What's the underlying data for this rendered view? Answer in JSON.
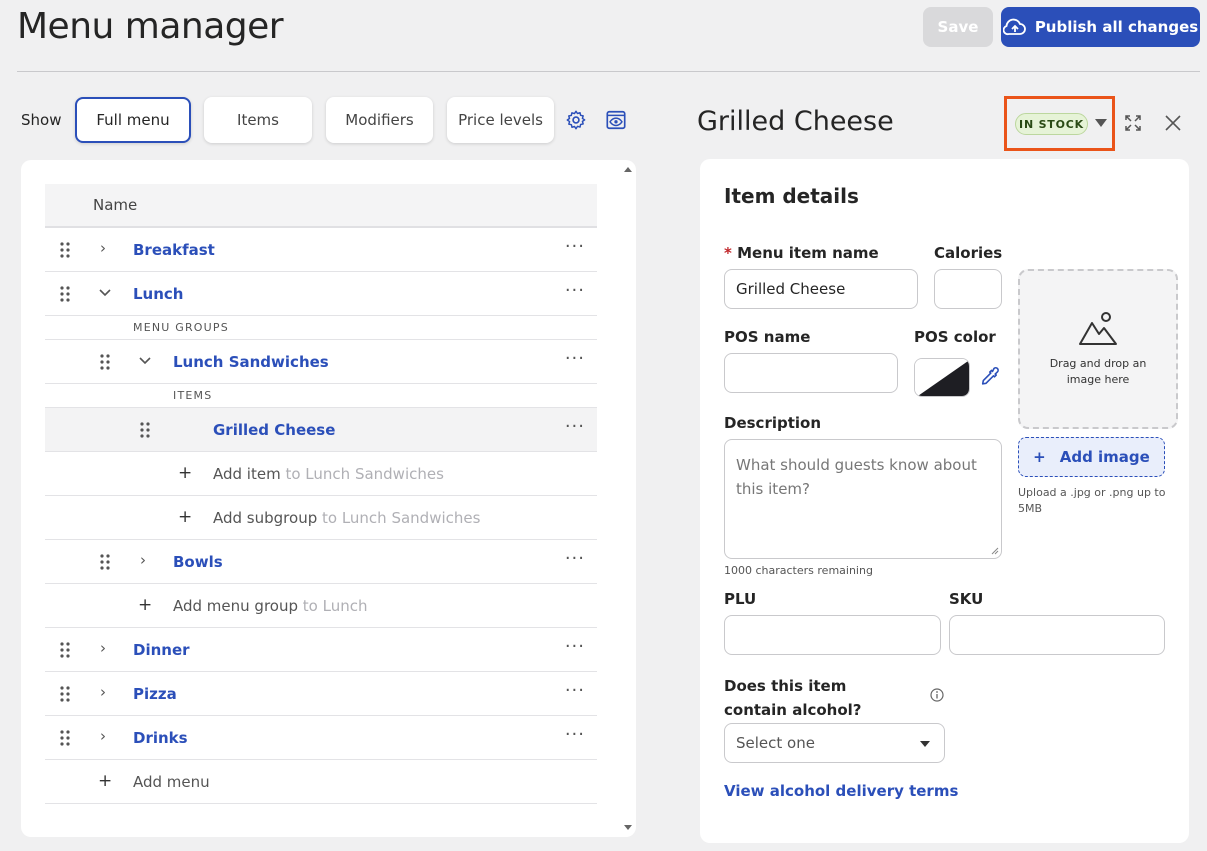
{
  "header": {
    "title": "Menu manager",
    "save_label": "Save",
    "publish_label": "Publish all changes"
  },
  "toolbar": {
    "show_label": "Show",
    "tabs": [
      {
        "label": "Full menu",
        "active": true
      },
      {
        "label": "Items",
        "active": false
      },
      {
        "label": "Modifiers",
        "active": false
      },
      {
        "label": "Price levels",
        "active": false
      }
    ]
  },
  "tree": {
    "column_header": "Name",
    "menus": {
      "breakfast": "Breakfast",
      "lunch": "Lunch",
      "dinner": "Dinner",
      "pizza": "Pizza",
      "drinks": "Drinks"
    },
    "menu_groups_label": "MENU GROUPS",
    "items_label": "ITEMS",
    "groups": {
      "lunch_sandwiches": "Lunch Sandwiches",
      "bowls": "Bowls"
    },
    "item_grilled_cheese": "Grilled Cheese",
    "add_item": {
      "text": "Add item",
      "hint": "to Lunch Sandwiches"
    },
    "add_subgroup": {
      "text": "Add subgroup",
      "hint": "to Lunch Sandwiches"
    },
    "add_menu_group": {
      "text": "Add menu group",
      "hint": "to Lunch"
    },
    "add_menu": "Add menu"
  },
  "detail": {
    "title": "Grilled Cheese",
    "stock_status": "IN STOCK",
    "section_title": "Item details",
    "menu_item_name_label": "Menu item name",
    "menu_item_name_value": "Grilled Cheese",
    "calories_label": "Calories",
    "calories_value": "",
    "pos_name_label": "POS name",
    "pos_name_value": "",
    "pos_color_label": "POS color",
    "description_label": "Description",
    "description_placeholder": "What should guests know about this item?",
    "chars_remaining": "1000 characters remaining",
    "dropzone_text": "Drag and drop an image here",
    "add_image_label": "Add image",
    "upload_hint": "Upload a .jpg or .png up to 5MB",
    "plu_label": "PLU",
    "sku_label": "SKU",
    "alcohol_label": "Does this item contain alcohol?",
    "alcohol_select": "Select one",
    "alcohol_link": "View alcohol delivery terms"
  },
  "colors": {
    "brand": "#2b4fb9",
    "highlight": "#ea5419",
    "stock_badge_bg": "#e6f3d7"
  }
}
